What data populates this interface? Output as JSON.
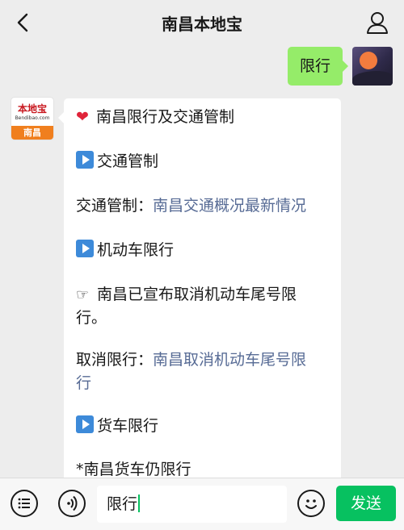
{
  "header": {
    "title": "南昌本地宝"
  },
  "my_message": {
    "text": "限行"
  },
  "bot": {
    "avatar": {
      "brand": "本地宝",
      "domain": "Bendibao.com",
      "city": "南昌"
    },
    "lines": {
      "title": "南昌限行及交通管制",
      "section1": "交通管制",
      "traffic_prefix": "交通管制：",
      "traffic_link": "南昌交通概况最新情况",
      "section2": "机动车限行",
      "notice_1": "南昌已宣布取消机动车尾号限",
      "notice_2": "行。",
      "cancel_prefix": "取消限行：",
      "cancel_link_1": "南昌取消机动车尾号限",
      "cancel_link_2": "行",
      "section3": "货车限行",
      "truck": "*南昌货车仍限行"
    }
  },
  "input_bar": {
    "value": "限行",
    "send_label": "发送"
  },
  "icons": [
    "back-arrow-icon",
    "person-icon",
    "heart-icon",
    "play-icon",
    "pointing-hand-icon",
    "menu-list-icon",
    "voice-icon",
    "emoji-icon"
  ],
  "colors": {
    "send": "#07c160",
    "my_bubble": "#95ec69",
    "link": "#576b95",
    "avatar_orange": "#f07f1e"
  }
}
